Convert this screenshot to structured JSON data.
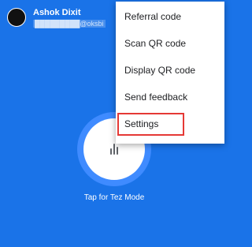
{
  "account": {
    "name": "Ashok Dixit",
    "email": "█████████@oksbi"
  },
  "menu": {
    "items": [
      {
        "label": "Referral code"
      },
      {
        "label": "Scan QR code"
      },
      {
        "label": "Display QR code"
      },
      {
        "label": "Send feedback"
      },
      {
        "label": "Settings"
      }
    ]
  },
  "tez": {
    "caption": "Tap for Tez Mode",
    "icon": "sound-bars-icon"
  },
  "colors": {
    "background": "#1a73e8",
    "highlight": "#e53935"
  }
}
